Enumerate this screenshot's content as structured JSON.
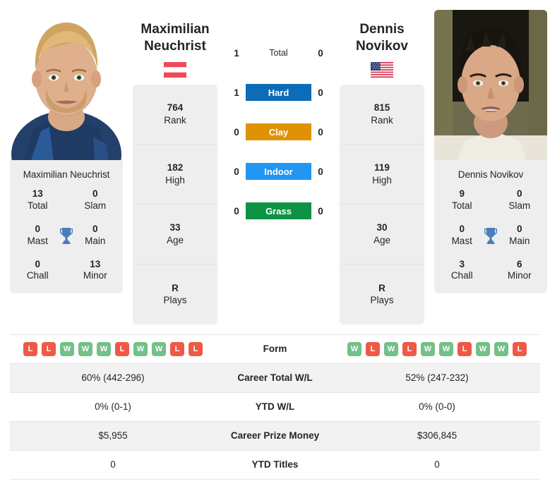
{
  "players": {
    "left": {
      "first_name": "Maximilian",
      "last_name": "Neuchrist",
      "full_name": "Maximilian Neuchrist",
      "country": "Austria",
      "flag_icon": "flag-austria-icon",
      "photo_alt": "Maximilian Neuchrist headshot",
      "titles": [
        {
          "value": "13",
          "label": "Total"
        },
        {
          "value": "0",
          "label": "Slam"
        },
        {
          "value": "0",
          "label": "Mast"
        },
        {
          "value": "0",
          "label": "Main"
        },
        {
          "value": "0",
          "label": "Chall"
        },
        {
          "value": "13",
          "label": "Minor"
        }
      ],
      "profile": [
        {
          "value": "764",
          "label": "Rank"
        },
        {
          "value": "182",
          "label": "High"
        },
        {
          "value": "33",
          "label": "Age"
        },
        {
          "value": "R",
          "label": "Plays"
        }
      ],
      "h2h": {
        "total": "1",
        "hard": "1",
        "clay": "0",
        "indoor": "0",
        "grass": "0"
      },
      "form": [
        "L",
        "L",
        "W",
        "W",
        "W",
        "L",
        "W",
        "W",
        "L",
        "L"
      ],
      "career_total_wl": "60% (442-296)",
      "ytd_wl": "0% (0-1)",
      "career_prize_money": "$5,955",
      "ytd_titles": "0"
    },
    "right": {
      "first_name": "Dennis",
      "last_name": "Novikov",
      "full_name": "Dennis Novikov",
      "country": "United States",
      "flag_icon": "flag-usa-icon",
      "photo_alt": "Dennis Novikov headshot",
      "titles": [
        {
          "value": "9",
          "label": "Total"
        },
        {
          "value": "0",
          "label": "Slam"
        },
        {
          "value": "0",
          "label": "Mast"
        },
        {
          "value": "0",
          "label": "Main"
        },
        {
          "value": "3",
          "label": "Chall"
        },
        {
          "value": "6",
          "label": "Minor"
        }
      ],
      "profile": [
        {
          "value": "815",
          "label": "Rank"
        },
        {
          "value": "119",
          "label": "High"
        },
        {
          "value": "30",
          "label": "Age"
        },
        {
          "value": "R",
          "label": "Plays"
        }
      ],
      "h2h": {
        "total": "0",
        "hard": "0",
        "clay": "0",
        "indoor": "0",
        "grass": "0"
      },
      "form": [
        "W",
        "L",
        "W",
        "L",
        "W",
        "W",
        "L",
        "W",
        "W",
        "L"
      ],
      "career_total_wl": "52% (247-232)",
      "ytd_wl": "0% (0-0)",
      "career_prize_money": "$306,845",
      "ytd_titles": "0"
    }
  },
  "surfaces": [
    {
      "key": "total",
      "label": "Total",
      "color": "transparent",
      "text_color": "#212529"
    },
    {
      "key": "hard",
      "label": "Hard",
      "color": "#0c6cb8",
      "text_color": "#ffffff"
    },
    {
      "key": "clay",
      "label": "Clay",
      "color": "#e09205",
      "text_color": "#ffffff"
    },
    {
      "key": "indoor",
      "label": "Indoor",
      "color": "#2196f3",
      "text_color": "#ffffff"
    },
    {
      "key": "grass",
      "label": "Grass",
      "color": "#0e9245",
      "text_color": "#ffffff"
    }
  ],
  "stats_rows": [
    {
      "label": "Form",
      "type": "form"
    },
    {
      "label": "Career Total W/L",
      "type": "text",
      "field": "career_total_wl"
    },
    {
      "label": "YTD W/L",
      "type": "text",
      "field": "ytd_wl"
    },
    {
      "label": "Career Prize Money",
      "type": "text",
      "field": "career_prize_money"
    },
    {
      "label": "YTD Titles",
      "type": "text",
      "field": "ytd_titles"
    }
  ],
  "theme": {
    "card_bg": "#eeeeee",
    "row_alt_bg": "#f2f2f2",
    "win_color": "#73c088",
    "loss_color": "#ef5945",
    "trophy_color": "#4a7ebb",
    "border_color": "#e4e4e4"
  }
}
